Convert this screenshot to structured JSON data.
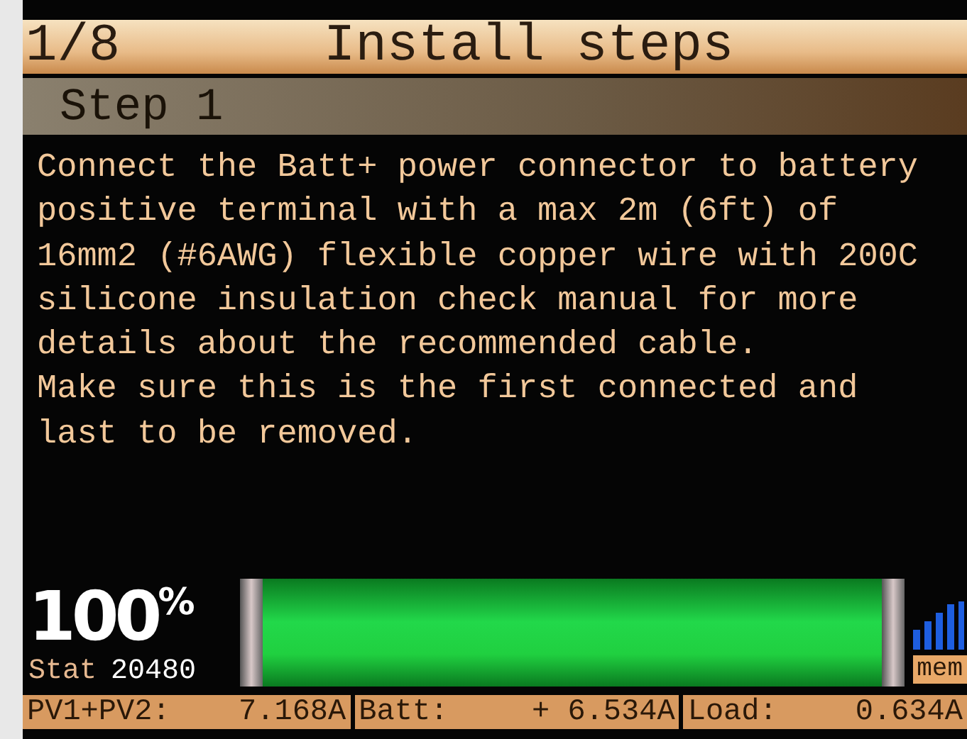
{
  "header": {
    "page": "1/8",
    "title": "Install steps"
  },
  "step": {
    "title": "Step 1"
  },
  "instructions": [
    "Connect the Batt+ power connector to battery",
    "positive terminal with a max 2m (6ft) of",
    "16mm2 (#6AWG) flexible copper wire with 200C",
    "silicone insulation check manual for more",
    "details about the recommended cable.",
    "Make sure this is the first connected and",
    "last to be removed."
  ],
  "battery": {
    "percent": "100",
    "unit": "%",
    "level": 1.0,
    "stat_label": "Stat",
    "stat_value": "20480"
  },
  "mem_label": "mem",
  "status_bar": [
    {
      "label": "PV1+PV2:",
      "value": "7.168A"
    },
    {
      "label": "Batt:",
      "value": "+ 6.534A"
    },
    {
      "label": "Load:",
      "value": "0.634A"
    }
  ]
}
